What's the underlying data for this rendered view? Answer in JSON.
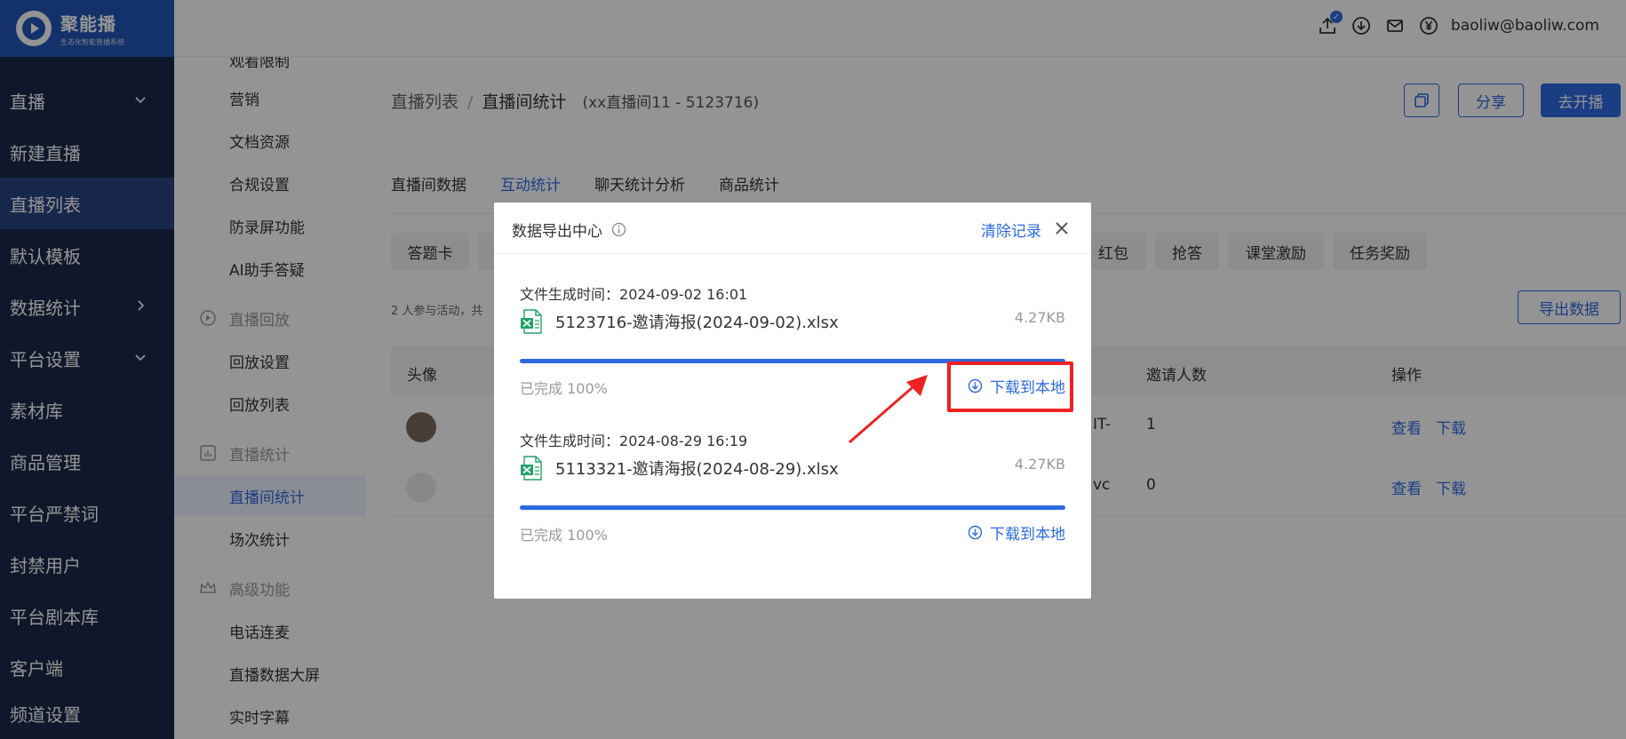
{
  "brand": {
    "name": "聚能播",
    "tagline": "生态化智能直播系统"
  },
  "nav": {
    "items": [
      {
        "label": "直播",
        "arrow": "down"
      },
      {
        "label": "新建直播"
      },
      {
        "label": "直播列表",
        "active": true
      },
      {
        "label": "默认模板"
      },
      {
        "label": "数据统计",
        "arrow": "right"
      },
      {
        "label": "平台设置",
        "arrow": "down"
      },
      {
        "label": "素材库"
      },
      {
        "label": "商品管理"
      },
      {
        "label": "平台严禁词"
      },
      {
        "label": "封禁用户"
      },
      {
        "label": "平台剧本库"
      },
      {
        "label": "客户端"
      },
      {
        "label": "频道设置"
      }
    ]
  },
  "subnav": {
    "top_cut": "观看限制",
    "items_a": [
      "营销",
      "文档资源",
      "合规设置",
      "防录屏功能",
      "AI助手答疑"
    ],
    "group_replay": "直播回放",
    "items_b": [
      "回放设置",
      "回放列表"
    ],
    "group_stats": "直播统计",
    "items_c": [
      "直播间统计",
      "场次统计"
    ],
    "group_adv": "高级功能",
    "items_d": [
      "电话连麦",
      "直播数据大屏",
      "实时字幕"
    ]
  },
  "topbar": {
    "user": "baoliw@baoliw.com",
    "badge": "✓"
  },
  "breadcrumb": {
    "parent": "直播列表",
    "sep": "/",
    "current": "直播间统计",
    "sub": "(xx直播间11 - 5123716)"
  },
  "header_buttons": {
    "share": "分享",
    "start": "去开播"
  },
  "tabs": [
    "直播间数据",
    "互动统计",
    "聊天统计分析",
    "商品统计"
  ],
  "chips": [
    "答题卡",
    "红包",
    "抢答",
    "课堂激励",
    "任务奖励"
  ],
  "stat_text": "2 人参与活动，共",
  "export_label": "导出数据",
  "table": {
    "headers": {
      "avatar": "头像",
      "invites": "邀请人数",
      "action": "操作"
    },
    "rows": [
      {
        "partial": "IT-",
        "invites": "1",
        "view": "查看",
        "download": "下载"
      },
      {
        "partial": "vc",
        "invites": "0",
        "view": "查看",
        "download": "下载"
      }
    ]
  },
  "dialog": {
    "title": "数据导出中心",
    "clear": "清除记录",
    "records": [
      {
        "time_label": "文件生成时间：",
        "time": "2024-09-02 16:01",
        "file": "5123716-邀请海报(2024-09-02).xlsx",
        "size": "4.27KB",
        "progress": 100,
        "status": "已完成 100%",
        "download": "下载到本地"
      },
      {
        "time_label": "文件生成时间：",
        "time": "2024-08-29 16:19",
        "file": "5113321-邀请海报(2024-08-29).xlsx",
        "size": "4.27KB",
        "progress": 100,
        "status": "已完成 100%",
        "download": "下载到本地"
      }
    ]
  },
  "colors": {
    "primary": "#2d6ae3",
    "nav_bg": "#1b2a4b",
    "annotation": "#ee2222"
  }
}
